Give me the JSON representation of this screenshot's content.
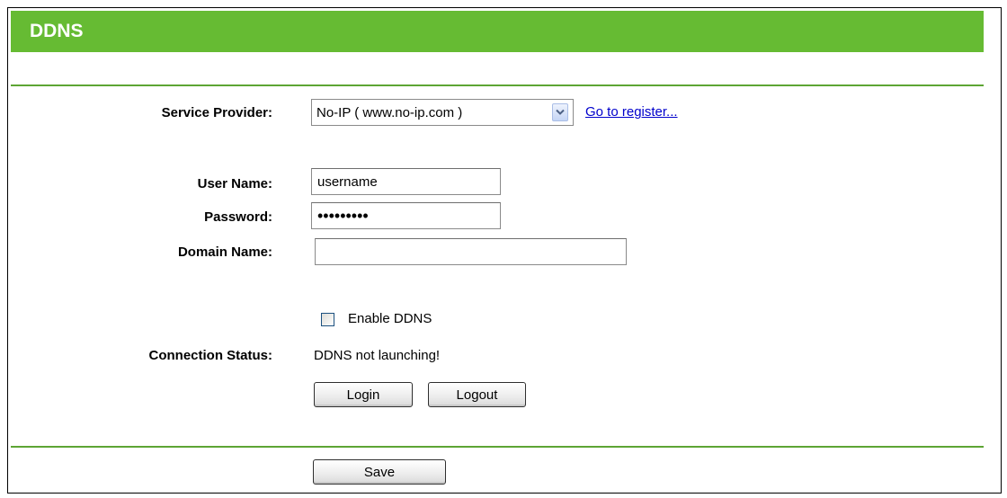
{
  "header": {
    "title": "DDNS"
  },
  "form": {
    "service_provider": {
      "label": "Service Provider:",
      "selected": "No-IP ( www.no-ip.com )",
      "link_text": "Go to register..."
    },
    "user_name": {
      "label": "User Name:",
      "value": "username"
    },
    "password": {
      "label": "Password:",
      "value": "•••••••••"
    },
    "domain_name": {
      "label": "Domain Name:",
      "value": ""
    },
    "enable_ddns": {
      "label": "Enable DDNS",
      "checked": false
    },
    "connection_status": {
      "label": "Connection Status:",
      "value": "DDNS not launching!"
    }
  },
  "buttons": {
    "login": "Login",
    "logout": "Logout",
    "save": "Save"
  },
  "colors": {
    "header_bg": "#66bb33",
    "rule": "#5da534",
    "link": "#0000cc"
  },
  "icons": {
    "select_arrow": "chevron-down-icon"
  }
}
